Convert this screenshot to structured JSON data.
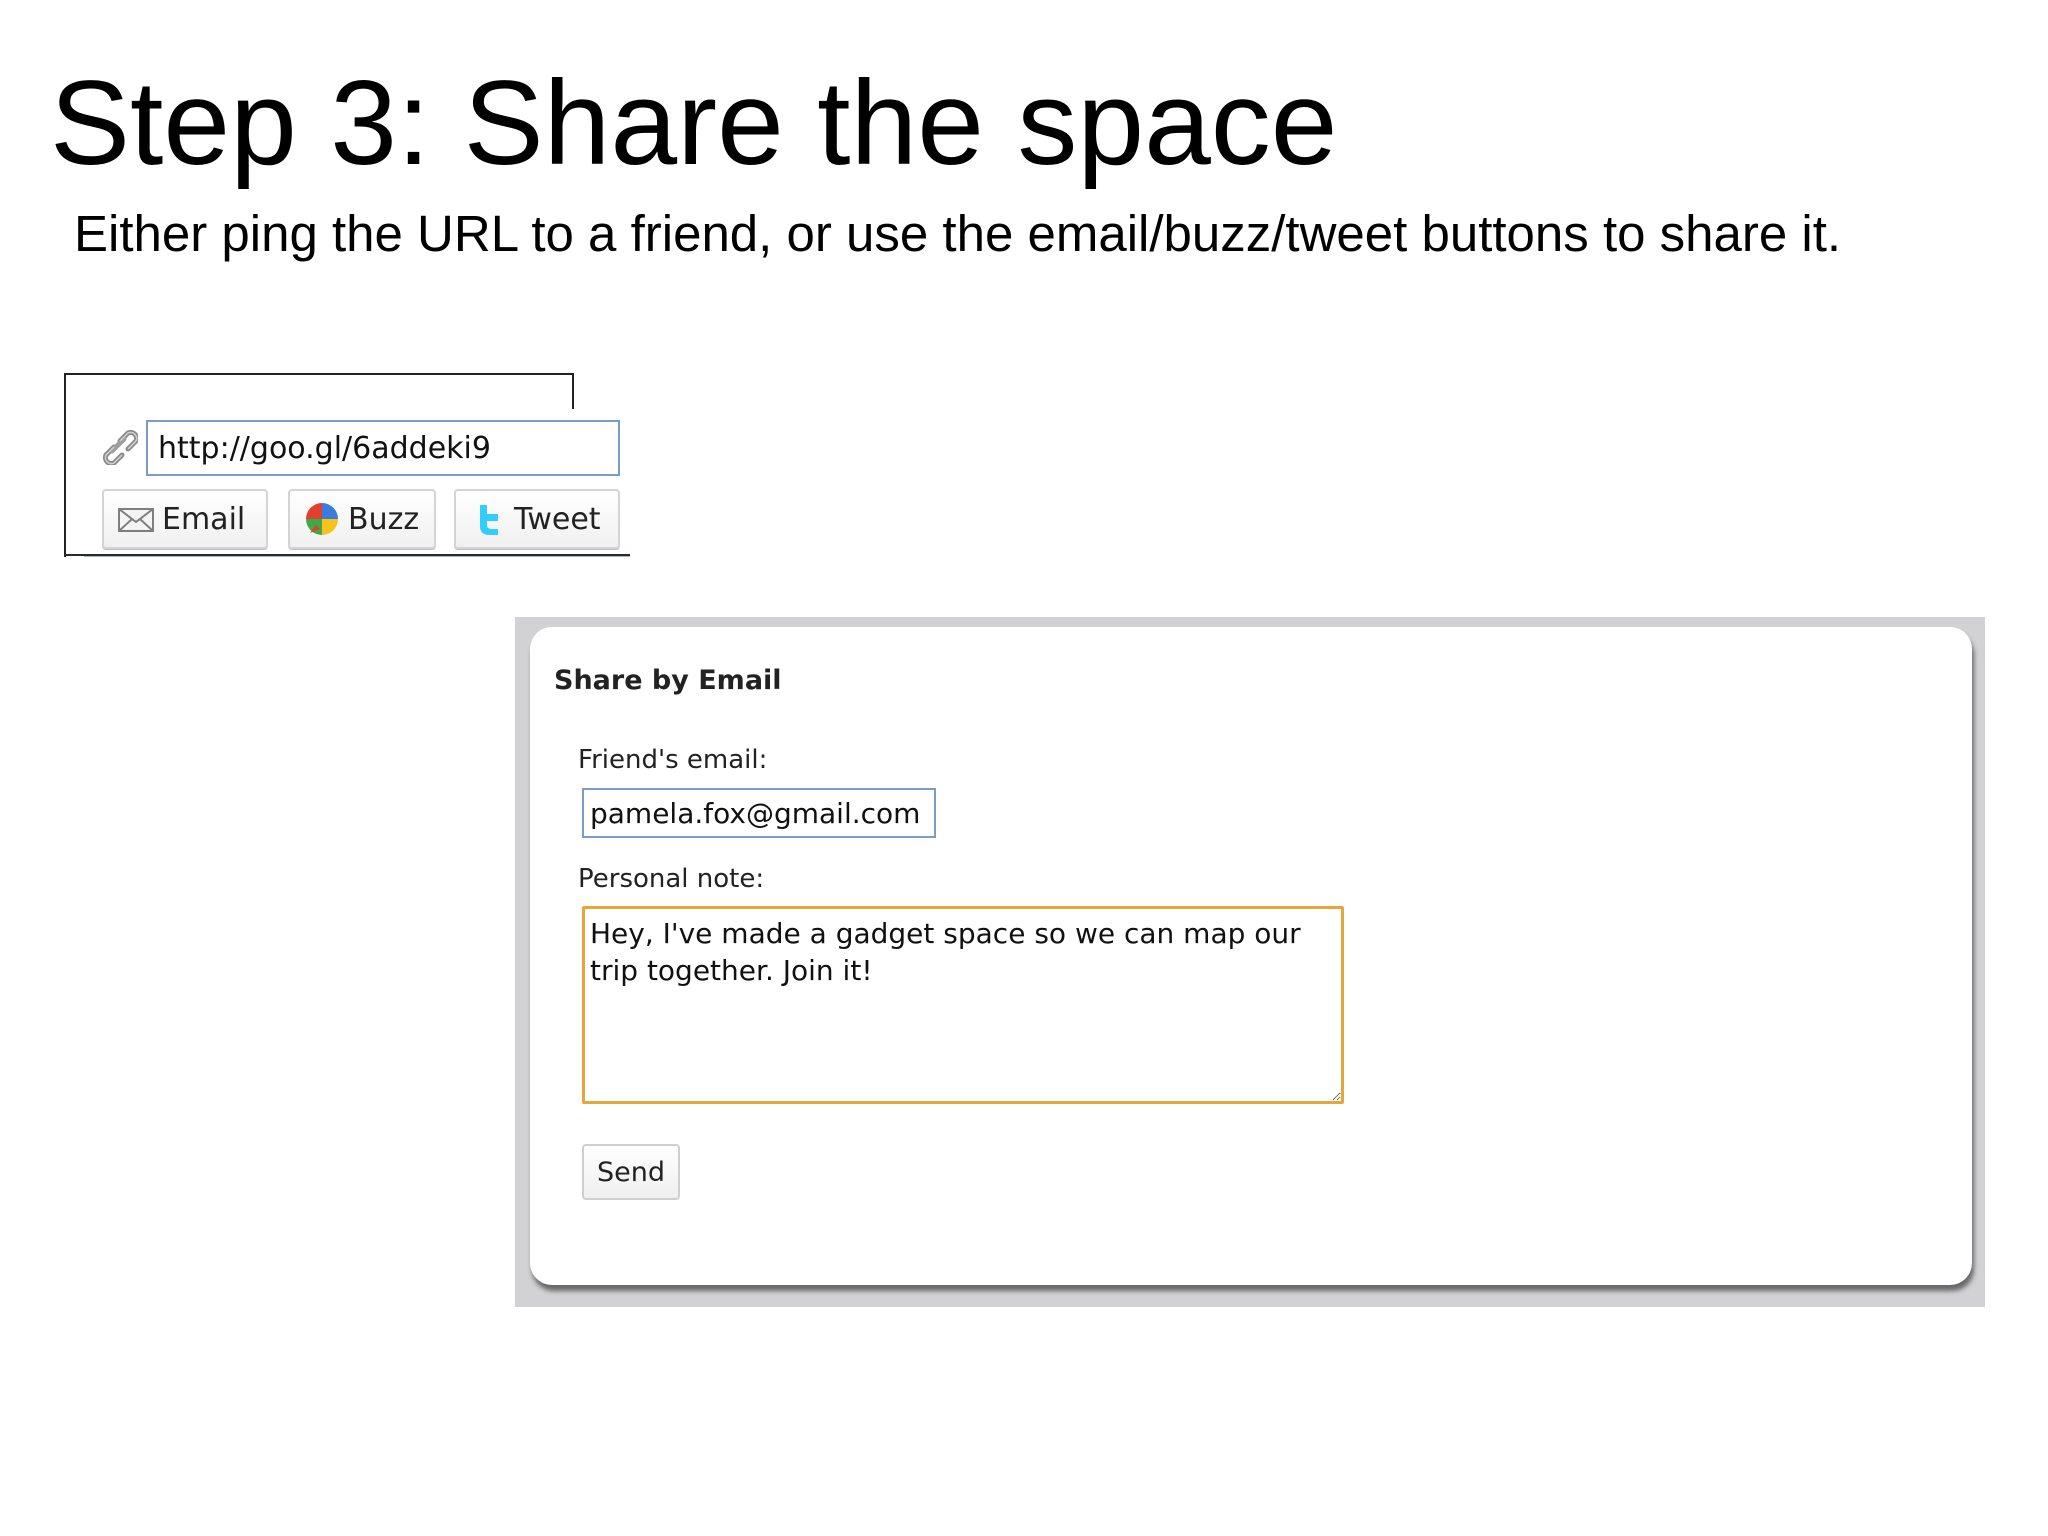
{
  "slide": {
    "title": "Step 3: Share the space",
    "subtitle": "Either ping the URL to a friend, or use the email/buzz/tweet buttons to share it."
  },
  "share_widget": {
    "url_value": "http://goo.gl/6addeki9",
    "link_icon": "chain-link-icon",
    "buttons": [
      {
        "label": "Email",
        "icon": "envelope-icon"
      },
      {
        "label": "Buzz",
        "icon": "google-buzz-icon"
      },
      {
        "label": "Tweet",
        "icon": "twitter-bird-icon"
      }
    ]
  },
  "email_panel": {
    "heading": "Share by Email",
    "friend_label": "Friend's email:",
    "friend_value": "pamela.fox@gmail.com",
    "note_label": "Personal note:",
    "note_value": "Hey, I've made a gadget space so we can map our trip together. Join it!",
    "send_label": "Send"
  },
  "colors": {
    "input_border": "#7a9cc6",
    "focus_border": "#e5a63c",
    "panel_background": "#d2d2d4",
    "twitter_blue": "#33ccff"
  }
}
